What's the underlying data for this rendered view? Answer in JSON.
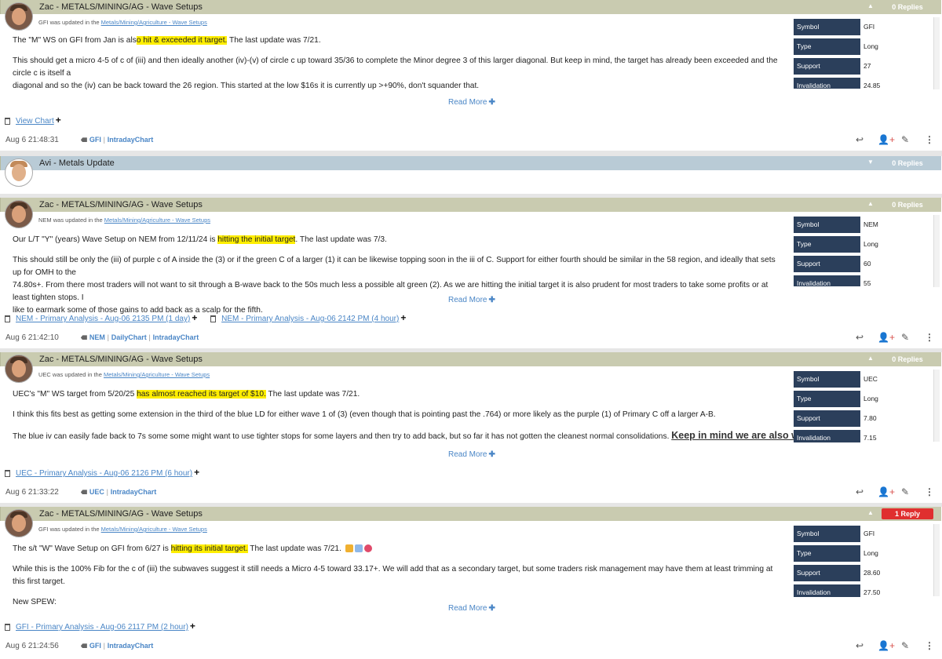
{
  "posts": [
    {
      "author": "Zac - METALS/MINING/AG - Wave Setups",
      "replies": "0 Replies",
      "update_prefix": "GFI was updated in the ",
      "update_link": "Metals/Mining/Agriculture - Wave Setups",
      "p1_pre": "The \"M\" WS on GFI from Jan is als",
      "p1_hl": "o hit & exceeded it target.",
      "p1_post": " The last update was 7/21.",
      "p2_line1": "This should get a micro 4-5 of c of (iii) and then ideally another (iv)-(v) of circle c up toward 35/36 to complete the Minor degree 3 of this larger diagonal. But keep in mind, the target has already been exceeded and the circle c is itself a",
      "p2_line2": "diagonal and so the (iv) can be back toward the 26 region. This started at the low $16s it is currently up >+90%, don't squander that.",
      "read_more": "Read More",
      "side": {
        "symbol_k": "Symbol",
        "symbol_v": "GFI",
        "type_k": "Type",
        "type_v": "Long",
        "support_k": "Support",
        "support_v": "27",
        "inval_k": "Invalidation",
        "inval_v": "24.85"
      },
      "chart_links": [
        "View Chart"
      ],
      "timestamp": "Aug 6 21:48:31",
      "tags": [
        "GFI",
        "IntradayChart"
      ]
    },
    {
      "author": "Avi - Metals Update",
      "replies": "0 Replies"
    },
    {
      "author": "Zac - METALS/MINING/AG - Wave Setups",
      "replies": "0 Replies",
      "update_prefix": "NEM was updated in the ",
      "update_link": "Metals/Mining/Agriculture - Wave Setups",
      "p1_pre": "Our L/T \"Y\" (years) Wave Setup on NEM from 12/11/24 is ",
      "p1_hl": "hitting the initial target",
      "p1_post": ". The last update was 7/3.",
      "p2_line1": "This should still be only the (iii) of purple c of A inside the (3) or if the green C of a larger (1) it can be likewise topping soon in the iii of C. Support for either fourth should be similar in the 58 region, and ideally that sets up for OMH to the",
      "p2_line2": "74.80s+. From there most traders will not want to sit through a B-wave back to the 50s much less a possible alt green (2). As we are hitting the initial target it is also prudent for most traders to take some profits or at least tighten stops. I",
      "p2_line3": "like to earmark some of those gains to add back as a scalp for the fifth.",
      "read_more": "Read More",
      "side": {
        "symbol_k": "Symbol",
        "symbol_v": "NEM",
        "type_k": "Type",
        "type_v": "Long",
        "support_k": "Support",
        "support_v": "60",
        "inval_k": "Invalidation",
        "inval_v": "55"
      },
      "chart_links": [
        "NEM - Primary Analysis - Aug-06 2135 PM (1 day)",
        "NEM - Primary Analysis - Aug-06 2142 PM (4 hour)"
      ],
      "timestamp": "Aug 6 21:42:10",
      "tags": [
        "NEM",
        "DailyChart",
        "IntradayChart"
      ]
    },
    {
      "author": "Zac - METALS/MINING/AG - Wave Setups",
      "replies": "0 Replies",
      "update_prefix": "UEC was updated in the ",
      "update_link": "Metals/Mining/Agriculture - Wave Setups",
      "p1_pre": "UEC's \"M\" WS target from 5/20/25 ",
      "p1_hl": "has almost reached its target of $10.",
      "p1_post": " The last update was 7/21.",
      "p2_line1": "I think this fits best as getting some extension in the third of the blue LD for either wave 1 of (3) (even though that is pointing past the .764) or more likely as the purple (1) of Primary C off a larger A-B.",
      "p3": "The blue iv can easily fade back to 7s some some might want to use tighter stops for some layers and then try to add back, but so far it has not gotten the cleanest normal consolidations.",
      "p3_big": "Keep in mind we are also within",
      "read_more": "Read More",
      "side": {
        "symbol_k": "Symbol",
        "symbol_v": "UEC",
        "type_k": "Type",
        "type_v": "Long",
        "support_k": "Support",
        "support_v": "7.80",
        "inval_k": "Invalidation",
        "inval_v": "7.15"
      },
      "chart_links": [
        "UEC - Primary Analysis - Aug-06 2126 PM (6 hour)"
      ],
      "timestamp": "Aug 6 21:33:22",
      "tags": [
        "UEC",
        "IntradayChart"
      ]
    },
    {
      "author": "Zac - METALS/MINING/AG - Wave Setups",
      "replies": "1 Reply",
      "update_prefix": "GFI was updated in the ",
      "update_link": "Metals/Mining/Agriculture - Wave Setups",
      "p1_pre": "The s/t \"W\" Wave Setup on GFI from 6/27 is ",
      "p1_hl": "hitting its initial target.",
      "p1_post": " The last update was 7/21.",
      "p2_line1": "While this is the 100% Fib for the c of (iii) the subwaves suggest it still needs a Micro 4-5 toward 33.17+. We will add that as a secondary target, but some traders risk management may have them at least trimming at this first target.",
      "p3": "New SPEW:",
      "read_more": "Read More",
      "side": {
        "symbol_k": "Symbol",
        "symbol_v": "GFI",
        "type_k": "Type",
        "type_v": "Long",
        "support_k": "Support",
        "support_v": "28.60",
        "inval_k": "Invalidation",
        "inval_v": "27.50"
      },
      "chart_links": [
        "GFI - Primary Analysis - Aug-06 2117 PM (2 hour)"
      ],
      "timestamp": "Aug 6 21:24:56",
      "tags": [
        "GFI",
        "IntradayChart"
      ]
    }
  ],
  "icons": {
    "reply": "reply-icon",
    "adduser": "add-user-icon",
    "edit": "pencil-icon",
    "more": "kebab-menu-icon"
  },
  "colors": {
    "header_green": "#c9cbb0",
    "header_blue": "#b9cbd6",
    "sidebar_label": "#2b3f5b",
    "link": "#4a86c6",
    "highlight": "#ffee00",
    "reply_badge": "#e02f2f"
  }
}
